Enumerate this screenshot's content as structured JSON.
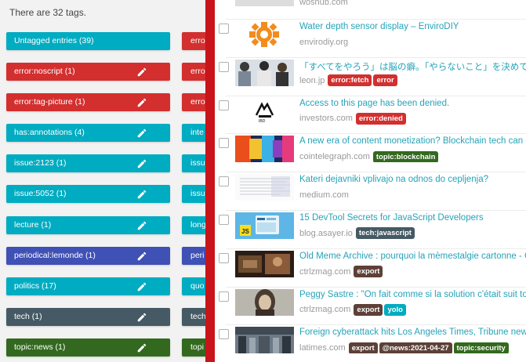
{
  "tags": {
    "count_text": "There are 32 tags.",
    "column1": [
      {
        "label": "Untagged entries (39)",
        "color": "#00acc1",
        "editable": false
      },
      {
        "label": "error:noscript (1)",
        "color": "#d32f2f",
        "editable": true
      },
      {
        "label": "error:tag-picture (1)",
        "color": "#d32f2f",
        "editable": true
      },
      {
        "label": "has:annotations (4)",
        "color": "#00acc1",
        "editable": true
      },
      {
        "label": "issue:2123 (1)",
        "color": "#00acc1",
        "editable": true
      },
      {
        "label": "issue:5052 (1)",
        "color": "#00acc1",
        "editable": true
      },
      {
        "label": "lecture (1)",
        "color": "#00acc1",
        "editable": true
      },
      {
        "label": "periodical:lemonde (1)",
        "color": "#3f51b5",
        "editable": true
      },
      {
        "label": "politics (17)",
        "color": "#00acc1",
        "editable": true
      },
      {
        "label": "tech (1)",
        "color": "#455a64",
        "editable": true
      },
      {
        "label": "topic:news (1)",
        "color": "#33691e",
        "editable": true
      }
    ],
    "column2": [
      {
        "label": "error",
        "color": "#d32f2f"
      },
      {
        "label": "error",
        "color": "#d32f2f"
      },
      {
        "label": "error",
        "color": "#d32f2f"
      },
      {
        "label": "inte",
        "color": "#00acc1"
      },
      {
        "label": "issu",
        "color": "#00acc1"
      },
      {
        "label": "issu",
        "color": "#00acc1"
      },
      {
        "label": "long",
        "color": "#00acc1"
      },
      {
        "label": "peri",
        "color": "#3f51b5"
      },
      {
        "label": "quo",
        "color": "#00acc1"
      },
      {
        "label": "tech",
        "color": "#455a64"
      },
      {
        "label": "topi",
        "color": "#33691e"
      }
    ]
  },
  "entries": {
    "top_partial_domain": "woshub.com",
    "items": [
      {
        "title": "Water depth sensor display – EnviroDIY",
        "domain": "envirodiy.org",
        "thumb": "gear",
        "tags": []
      },
      {
        "title": "「すべてをやろう」は脳の癖。「やらないこと」を決めて",
        "domain": "leon.jp",
        "thumb": "people",
        "tags": [
          {
            "label": "error:fetch",
            "color": "#d32f2f"
          },
          {
            "label": "error",
            "color": "#d32f2f"
          }
        ]
      },
      {
        "title": "Access to this page has been denied.",
        "domain": "investors.com",
        "thumb": "logo",
        "tags": [
          {
            "label": "error:denied",
            "color": "#d32f2f"
          }
        ]
      },
      {
        "title": "A new era of content monetization? Blockchain tech can g",
        "domain": "cointelegraph.com",
        "thumb": "colorful",
        "tags": [
          {
            "label": "topic:blockchain",
            "color": "#33691e"
          }
        ]
      },
      {
        "title": "Kateri dejavniki vplivajo na odnos do cepljenja?",
        "domain": "medium.com",
        "thumb": "text",
        "tags": []
      },
      {
        "title": "15 DevTool Secrets for JavaScript Developers",
        "domain": "blog.asayer.io",
        "thumb": "js",
        "tags": [
          {
            "label": "tech:javascript",
            "color": "#455a64"
          }
        ]
      },
      {
        "title": "Old Meme Archive : pourquoi la mèmestalgie cartonne - C",
        "domain": "ctrlzmag.com",
        "thumb": "dark",
        "tags": [
          {
            "label": "export",
            "color": "#5d4037"
          }
        ]
      },
      {
        "title": "Peggy Sastre : \"On fait comme si la solution c'était suit to",
        "domain": "ctrlzmag.com",
        "thumb": "portrait",
        "tags": [
          {
            "label": "export",
            "color": "#5d4037"
          },
          {
            "label": "yolo",
            "color": "#00acc1"
          }
        ]
      },
      {
        "title": "Foreign cyberattack hits Los Angeles Times, Tribune news",
        "domain": "latimes.com",
        "thumb": "station",
        "tags": [
          {
            "label": "export",
            "color": "#5d4037"
          },
          {
            "label": "@news:2021-04-27",
            "color": "#5d4037"
          },
          {
            "label": "topic:security",
            "color": "#33691e"
          }
        ]
      }
    ]
  }
}
